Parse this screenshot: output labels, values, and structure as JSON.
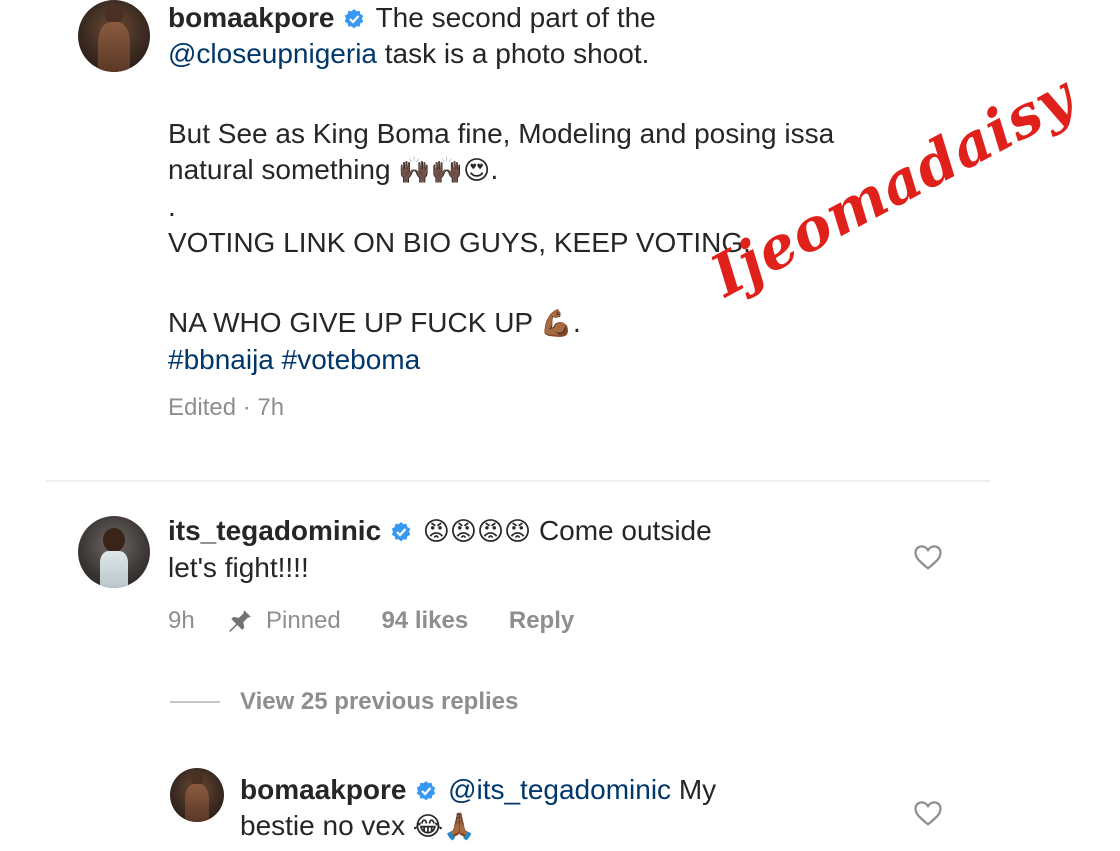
{
  "post": {
    "username": "bomaakpore",
    "line1_text": "The second part of the",
    "mention": "@closeupnigeria",
    "line2_text": "task is a photo shoot.",
    "para2": "But See as King Boma fine, Modeling and posing issa",
    "para2_line2": "natural something",
    "para2_emojis": "🙌🏿🙌🏿😍.",
    "dot": ".",
    "para3": "VOTING LINK ON BIO GUYS, KEEP VOTING.",
    "para4": "NA WHO GIVE UP FUCK UP",
    "para4_emoji": "💪🏾.",
    "hashtags": "#bbnaija #voteboma",
    "meta": "Edited · 7h"
  },
  "watermark": "Ijeomadaisy",
  "comment1": {
    "username": "its_tegadominic",
    "emojis": "😡😡😡😡",
    "text1": "Come outside",
    "text2": "let's fight!!!!",
    "time": "9h",
    "pinned": "Pinned",
    "likes": "94 likes",
    "reply": "Reply"
  },
  "view_replies": "View 25 previous replies",
  "reply1": {
    "username": "bomaakpore",
    "mention": "@its_tegadominic",
    "text1": "My",
    "text2": "bestie no vex",
    "emojis": "😂🙏🏾"
  },
  "colors": {
    "link": "#00376b",
    "meta": "#8e8e8e",
    "verified": "#3897f0",
    "watermark": "#e0201b"
  },
  "icons": [
    "verified-badge-icon",
    "pin-icon",
    "heart-icon",
    "avatar-image"
  ]
}
